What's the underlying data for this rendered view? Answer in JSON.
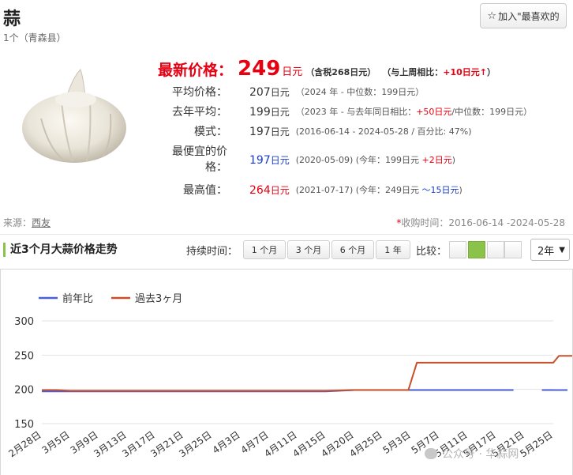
{
  "header": {
    "title": "蒜",
    "subtitle": "1个（青森县）",
    "favorite_label": "加入\"最喜欢的"
  },
  "latest": {
    "label": "最新价格：",
    "value": "249",
    "unit": "日元",
    "tax": "（含税268日元）",
    "compare_prefix": "（与上周相比：",
    "compare_value": "+10日元↑",
    "compare_suffix": "）"
  },
  "stats": [
    {
      "label": "平均价格：",
      "value": "207",
      "unit": "日元",
      "note_parts": [
        "（2024 年 - 中位数：199日元）"
      ]
    },
    {
      "label": "去年平均：",
      "value": "199",
      "unit": "日元",
      "note_parts": [
        "（2023 年 - 与去年同日相比：",
        "+50日元",
        "/中位数：199日元）"
      ]
    },
    {
      "label": "模式：",
      "value": "197",
      "unit": "日元",
      "note_parts": [
        "(2016-06-14 - 2024-05-28 / 百分比: 47%)"
      ]
    },
    {
      "label_line1": "最便宜的价",
      "label_line2": "格：",
      "value": "197",
      "unit": "日元",
      "note_parts": [
        "(2020-05-09) (今年：199日元 ",
        "+2日元",
        ")"
      ]
    },
    {
      "label": "最高值：",
      "value": "264",
      "unit": "日元",
      "note_parts": [
        "(2021-07-17) (今年：249日元 ",
        "～15日元",
        ")"
      ]
    }
  ],
  "source": {
    "label": "来源：",
    "link": "西友"
  },
  "period": {
    "asterisk": "*",
    "text": "收购时间：2016-06-14 -2024-05-28"
  },
  "section_title": "近3个月大蒜价格走势",
  "duration": {
    "label": "持续时间：",
    "buttons": [
      "1 个月",
      "3 个月",
      "6 个月",
      "1 年"
    ]
  },
  "compare": {
    "label": "比较：",
    "active_index": 1
  },
  "year_select": "2年",
  "colors": {
    "accent_red": "#e60012",
    "accent_green": "#8bc34a",
    "blue": "#1a3cc8",
    "series_prev": "#4a5fd6",
    "series_3m": "#c7502a"
  },
  "icons": {
    "favorite": "star-outline-icon",
    "select": "chevron-down-icon"
  },
  "watermark": "公众号 · 华蒜网",
  "chart_data": {
    "type": "line",
    "title": "",
    "xlabel": "",
    "ylabel": "",
    "ylim": [
      150,
      300
    ],
    "yticks": [
      150,
      200,
      250,
      300
    ],
    "grid": true,
    "legend": "top-left",
    "categories": [
      "2月28日",
      "3月5日",
      "3月9日",
      "3月13日",
      "3月17日",
      "3月21日",
      "3月25日",
      "4月3日",
      "4月7日",
      "4月11日",
      "4月15日",
      "4月20日",
      "4月25日",
      "5月3日",
      "5月7日",
      "5月11日",
      "5月17日",
      "5月21日",
      "5月25日"
    ],
    "series": [
      {
        "name": "前年比",
        "color": "#4a5fd6",
        "points": [
          [
            0,
            197
          ],
          [
            1,
            197
          ],
          [
            2,
            197
          ],
          [
            3,
            197
          ],
          [
            4,
            197
          ],
          [
            5,
            197
          ],
          [
            6,
            197
          ],
          [
            7,
            197
          ],
          [
            8,
            197
          ],
          [
            9,
            197
          ],
          [
            10,
            197
          ],
          [
            11,
            199
          ],
          [
            12,
            199
          ],
          [
            13,
            199
          ],
          [
            14,
            199
          ],
          [
            15,
            199
          ],
          [
            16,
            199
          ],
          [
            16.6,
            199
          ],
          [
            null,
            null
          ],
          [
            17.6,
            199
          ],
          [
            18.5,
            199
          ]
        ]
      },
      {
        "name": "過去3ヶ月",
        "color": "#c7502a",
        "points": [
          [
            0,
            199
          ],
          [
            0.5,
            199
          ],
          [
            1,
            198
          ],
          [
            2,
            198
          ],
          [
            3,
            198
          ],
          [
            4,
            198
          ],
          [
            5,
            198
          ],
          [
            6,
            198
          ],
          [
            7,
            198
          ],
          [
            8,
            198
          ],
          [
            9,
            198
          ],
          [
            10,
            198
          ],
          [
            11,
            199
          ],
          [
            12,
            199
          ],
          [
            12.9,
            199
          ],
          [
            13.2,
            239
          ],
          [
            14,
            239
          ],
          [
            15,
            239
          ],
          [
            16,
            239
          ],
          [
            17,
            239
          ],
          [
            18,
            239
          ],
          [
            18.2,
            249
          ],
          [
            18.7,
            249
          ]
        ]
      }
    ]
  }
}
